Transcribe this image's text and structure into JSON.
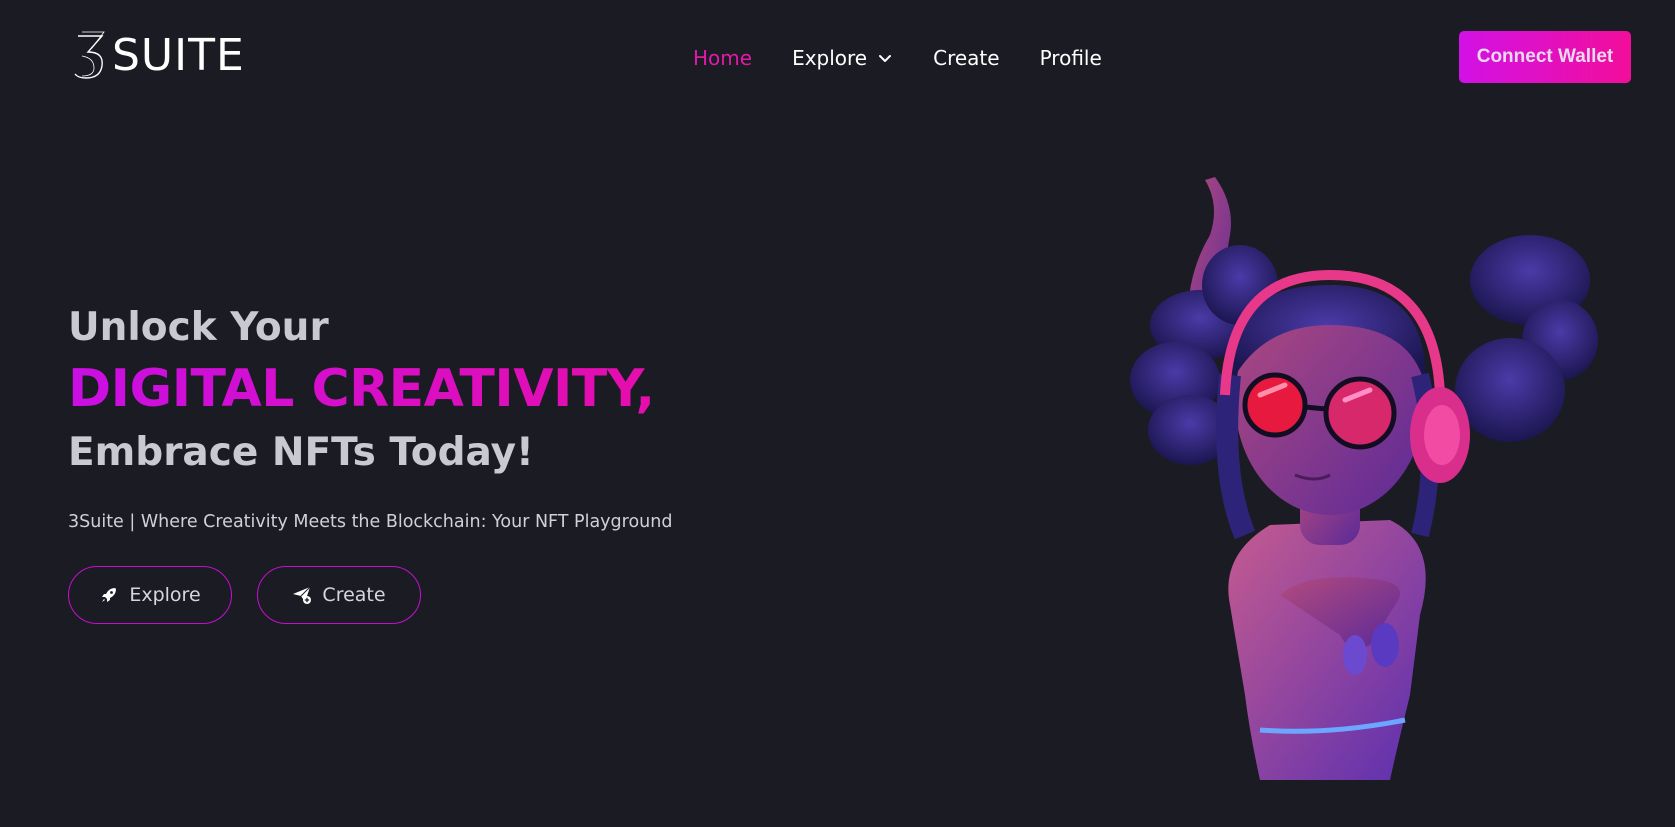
{
  "logo": {
    "mark": "3",
    "text": "SUITE"
  },
  "nav": {
    "items": [
      {
        "label": "Home",
        "active": true
      },
      {
        "label": "Explore",
        "has_dropdown": true,
        "icon": "chevron-down-icon"
      },
      {
        "label": "Create"
      },
      {
        "label": "Profile"
      }
    ]
  },
  "header": {
    "connect_label": "Connect Wallet"
  },
  "hero": {
    "line1": "Unlock Your",
    "line2": "DIGITAL CREATIVITY,",
    "line3": "Embrace NFTs Today!",
    "tagline": "3Suite | Where Creativity Meets the Blockchain: Your NFT Playground",
    "buttons": [
      {
        "label": "Explore",
        "icon": "rocket-icon"
      },
      {
        "label": "Create",
        "icon": "paper-plane-add-icon"
      }
    ]
  },
  "colors": {
    "background": "#1b1b24",
    "accent_start": "#d211e6",
    "accent_end": "#f20e9a",
    "active_nav": "#e01aa6",
    "headline_gray": "#c9c9d0"
  }
}
